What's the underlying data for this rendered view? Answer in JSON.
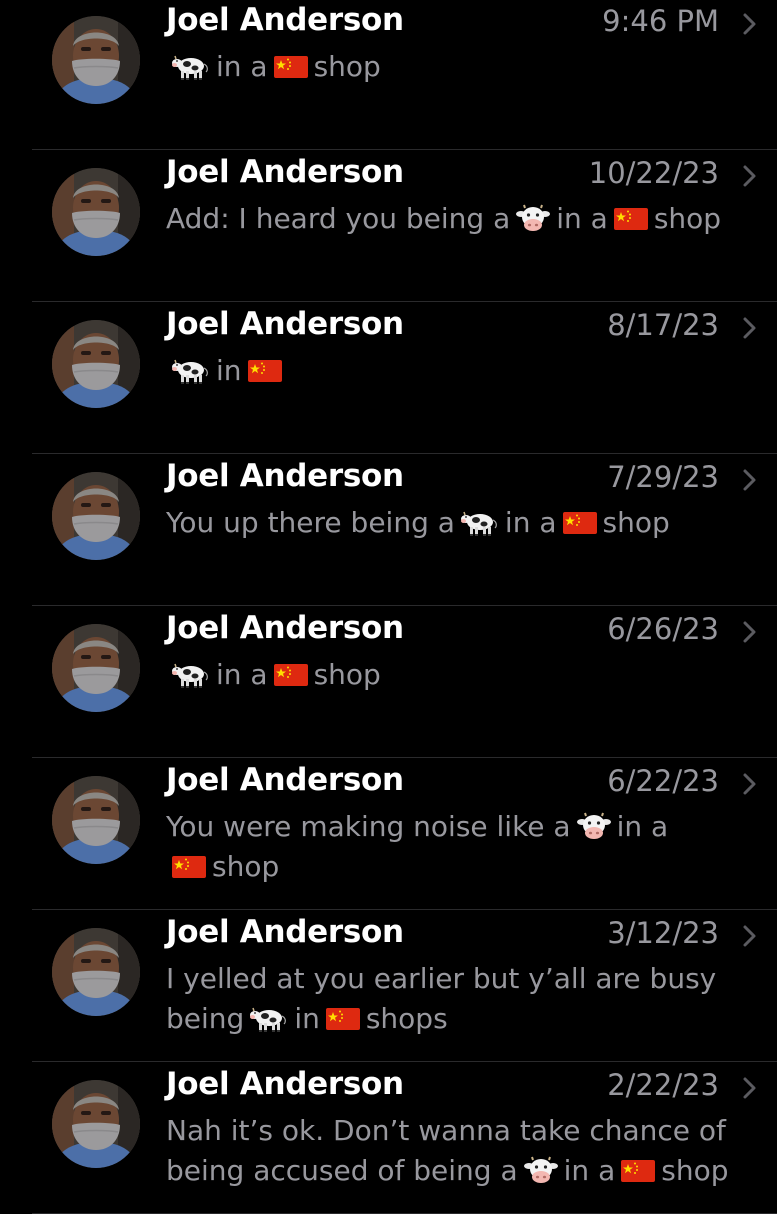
{
  "conversations": [
    {
      "name": "Joel Anderson",
      "time": "9:46 PM",
      "preview": [
        [
          {
            "e": "cow"
          },
          {
            "t": "in a"
          },
          {
            "e": "china-flag"
          },
          {
            "t": "shop"
          }
        ]
      ]
    },
    {
      "name": "Joel Anderson",
      "time": "10/22/23",
      "preview": [
        [
          {
            "t": "Add: I heard you being a"
          },
          {
            "e": "cow-face"
          },
          {
            "t": "in a"
          },
          {
            "e": "china-flag"
          },
          {
            "t": "shop"
          }
        ]
      ]
    },
    {
      "name": "Joel Anderson",
      "time": "8/17/23",
      "preview": [
        [
          {
            "e": "cow"
          },
          {
            "t": "in"
          },
          {
            "e": "china-flag"
          }
        ]
      ]
    },
    {
      "name": "Joel Anderson",
      "time": "7/29/23",
      "preview": [
        [
          {
            "t": "You up there being a"
          },
          {
            "e": "cow"
          },
          {
            "t": "in a"
          },
          {
            "e": "china-flag"
          },
          {
            "t": "shop"
          }
        ]
      ]
    },
    {
      "name": "Joel Anderson",
      "time": "6/26/23",
      "preview": [
        [
          {
            "e": "cow"
          },
          {
            "t": "in a"
          },
          {
            "e": "china-flag"
          },
          {
            "t": "shop"
          }
        ]
      ]
    },
    {
      "name": "Joel Anderson",
      "time": "6/22/23",
      "preview": [
        [
          {
            "t": "You were making noise like a"
          },
          {
            "e": "cow-face"
          },
          {
            "t": "in a"
          }
        ],
        [
          {
            "e": "china-flag"
          },
          {
            "t": "shop"
          }
        ]
      ]
    },
    {
      "name": "Joel Anderson",
      "time": "3/12/23",
      "preview": [
        [
          {
            "t": "I yelled at you earlier but y’all are busy"
          }
        ],
        [
          {
            "t": "being"
          },
          {
            "e": "cow"
          },
          {
            "t": "in"
          },
          {
            "e": "china-flag"
          },
          {
            "t": "shops"
          }
        ]
      ]
    },
    {
      "name": "Joel Anderson",
      "time": "2/22/23",
      "preview": [
        [
          {
            "t": "Nah it’s ok. Don’t wanna take chance of"
          }
        ],
        [
          {
            "t": "being accused of being a"
          },
          {
            "e": "cow-face"
          },
          {
            "t": "in a"
          },
          {
            "e": "china-flag"
          },
          {
            "t": "shop"
          }
        ]
      ]
    }
  ],
  "icons": {
    "row_chevron": "chevron-right-icon",
    "avatar": "contact-photo"
  },
  "colors": {
    "background": "#000000",
    "name_text": "#ffffff",
    "secondary_text": "#98989e",
    "divider": "#2a2a2c"
  }
}
